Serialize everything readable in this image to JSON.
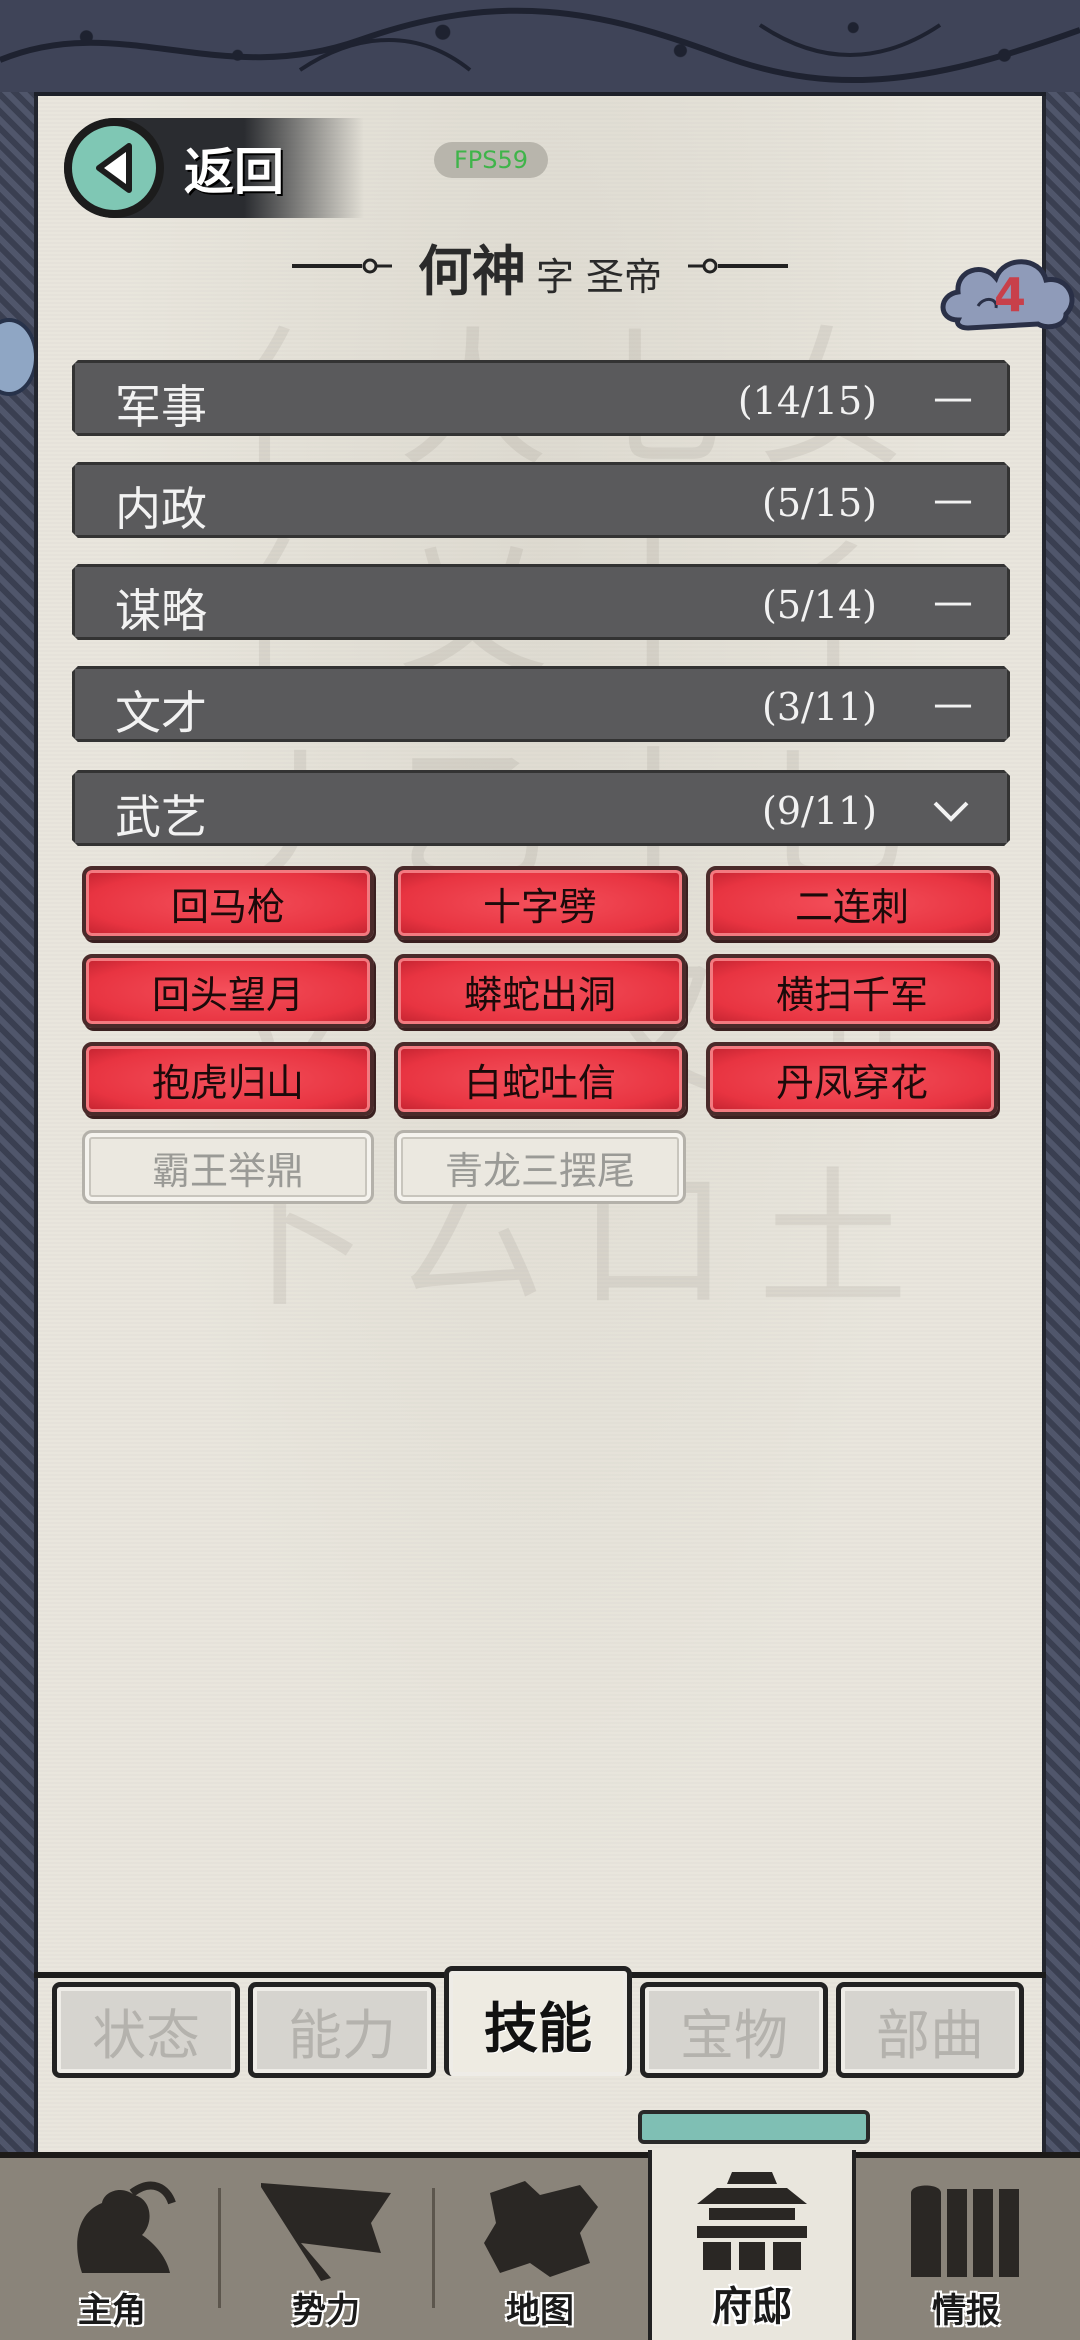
{
  "header": {
    "back_label": "返回",
    "fps_text": "FPS59",
    "hero_name": "何神",
    "hero_courtesy": "字 圣帝",
    "badge_count": "4"
  },
  "categories": [
    {
      "name": "军事",
      "count": "(14/15)",
      "state": "—"
    },
    {
      "name": "内政",
      "count": "(5/15)",
      "state": "—"
    },
    {
      "name": "谋略",
      "count": "(5/14)",
      "state": "—"
    },
    {
      "name": "文才",
      "count": "(3/11)",
      "state": "—"
    },
    {
      "name": "武艺",
      "count": "(9/11)",
      "state": "expanded"
    }
  ],
  "skills": [
    {
      "label": "回马枪",
      "owned": true
    },
    {
      "label": "十字劈",
      "owned": true
    },
    {
      "label": "二连刺",
      "owned": true
    },
    {
      "label": "回头望月",
      "owned": true
    },
    {
      "label": "蟒蛇出洞",
      "owned": true
    },
    {
      "label": "横扫千军",
      "owned": true
    },
    {
      "label": "抱虎归山",
      "owned": true
    },
    {
      "label": "白蛇吐信",
      "owned": true
    },
    {
      "label": "丹凤穿花",
      "owned": true
    },
    {
      "label": "霸王举鼎",
      "owned": false
    },
    {
      "label": "青龙三摆尾",
      "owned": false
    }
  ],
  "tabs": [
    {
      "label": "状态",
      "active": false
    },
    {
      "label": "能力",
      "active": false
    },
    {
      "label": "技能",
      "active": true
    },
    {
      "label": "宝物",
      "active": false
    },
    {
      "label": "部曲",
      "active": false
    }
  ],
  "nav": [
    {
      "label": "主角",
      "icon": "warrior-icon",
      "active": false
    },
    {
      "label": "势力",
      "icon": "flag-icon",
      "active": false
    },
    {
      "label": "地图",
      "icon": "map-icon",
      "active": false
    },
    {
      "label": "府邸",
      "icon": "mansion-icon",
      "active": true
    },
    {
      "label": "情报",
      "icon": "scroll-icon",
      "active": false
    }
  ],
  "colors": {
    "skill_owned": "#e83441",
    "category_bar": "#5a5a5c",
    "paper": "#e9e6dd",
    "back_circle": "#7fc7b4",
    "badge_number": "#c8404a"
  }
}
